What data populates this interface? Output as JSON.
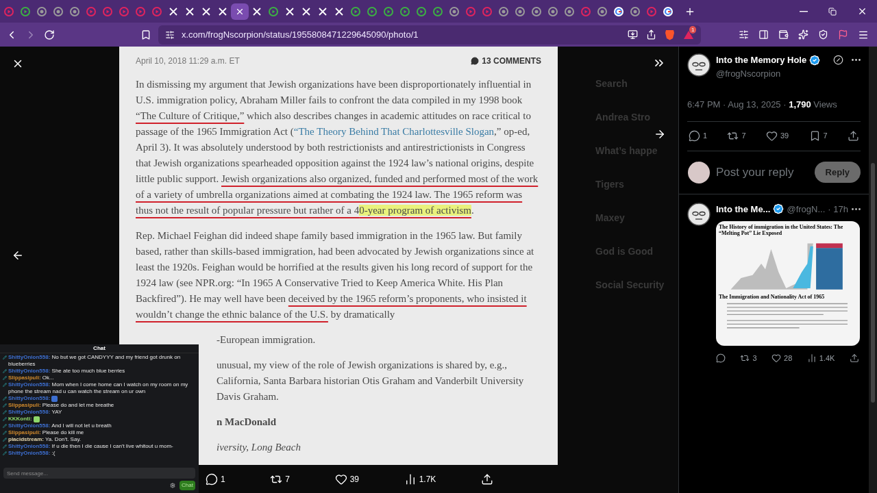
{
  "browser": {
    "tabs": [
      {
        "kind": "media",
        "selected": false
      },
      {
        "kind": "play",
        "selected": false
      },
      {
        "kind": "site",
        "selected": false
      },
      {
        "kind": "site",
        "selected": false
      },
      {
        "kind": "site",
        "selected": false
      },
      {
        "kind": "media",
        "selected": false
      },
      {
        "kind": "media",
        "selected": false
      },
      {
        "kind": "media",
        "selected": false
      },
      {
        "kind": "media",
        "selected": false
      },
      {
        "kind": "media",
        "selected": false
      },
      {
        "kind": "x",
        "selected": false
      },
      {
        "kind": "x",
        "selected": false
      },
      {
        "kind": "x",
        "selected": false
      },
      {
        "kind": "x",
        "selected": false
      },
      {
        "selected": true
      },
      {
        "kind": "x",
        "selected": false
      },
      {
        "kind": "play",
        "selected": false
      },
      {
        "kind": "x",
        "selected": false
      },
      {
        "kind": "x",
        "selected": false
      },
      {
        "kind": "x",
        "selected": false
      },
      {
        "kind": "x",
        "selected": false
      },
      {
        "kind": "play",
        "selected": false
      },
      {
        "kind": "play",
        "selected": false
      },
      {
        "kind": "play",
        "selected": false
      },
      {
        "kind": "play",
        "selected": false
      },
      {
        "kind": "play",
        "selected": false
      },
      {
        "kind": "play",
        "selected": false
      },
      {
        "kind": "site",
        "selected": false
      },
      {
        "kind": "media",
        "selected": false
      },
      {
        "kind": "media",
        "selected": false
      },
      {
        "kind": "site",
        "selected": false
      },
      {
        "kind": "site",
        "selected": false
      },
      {
        "kind": "site",
        "selected": false
      },
      {
        "kind": "site",
        "selected": false
      },
      {
        "kind": "site",
        "selected": false
      },
      {
        "kind": "media",
        "selected": false
      },
      {
        "kind": "site",
        "selected": false
      },
      {
        "kind": "google",
        "selected": false
      },
      {
        "kind": "site",
        "selected": false
      },
      {
        "kind": "media",
        "selected": false
      },
      {
        "kind": "google",
        "selected": false
      }
    ],
    "url": "x.com/frogNscorpion/status/1955808471229645090/photo/1",
    "rewards_badge": "1"
  },
  "background_page": [
    "Search",
    "Andrea Stro",
    "What’s happe",
    "Tigers",
    "Maxey",
    "God is Good",
    "Social Security"
  ],
  "letter": {
    "date": "April 10, 2018 11:29 a.m. ET",
    "comments": "13 COMMENTS",
    "blocks": [
      {
        "kind": "paragraph",
        "runs": [
          {
            "kind": "plain",
            "text": "In dismissing my argument that Jewish organizations have been disproportionately influential in U.S. immigration policy, Abraham Miller fails to confront the data compiled in my 1998 book "
          },
          {
            "kind": "underline",
            "text": "“The Culture of Critique,”"
          },
          {
            "kind": "plain",
            "text": " which also describes changes in academic attitudes on race critical to passage of the 1965 Immigration Act ("
          },
          {
            "kind": "link",
            "text": "“The Theory Behind That Charlottesville Slogan"
          },
          {
            "kind": "plain",
            "text": ",” op-ed, April 3). It was absolutely understood by both restrictionists and antirestrictionists in Congress that Jewish organizations spearheaded opposition against the 1924 law’s national origins, despite little public support. "
          },
          {
            "kind": "underline",
            "text": "Jewish organizations also organized, funded and performed most of the work of a variety of umbrella organizations aimed at combating the 1924 law. The 1965 reform was thus not the result of popular pressure but rather of a 4"
          },
          {
            "kind": "highlight",
            "text": "0-year program of activism"
          },
          {
            "kind": "plain",
            "text": "."
          }
        ]
      },
      {
        "kind": "paragraph",
        "runs": [
          {
            "kind": "plain",
            "text": "Rep. Michael Feighan did indeed shape family based immigration in the 1965 law. But family based, rather than skills-based immigration, had been advocated by Jewish organizations since at least the 1920s. Feighan would be horrified at the results given his long record of support for the 1924 law (see NPR.org: “In 1965 A Conservative Tried to Keep America White. His Plan Backfired”). He may well have been "
          },
          {
            "kind": "underline",
            "text": "deceived by the 1965 reform’s proponents, who insisted it wouldn’t change the ethnic balance of the U.S."
          },
          {
            "kind": "plain",
            "text": " by dramatically"
          }
        ]
      },
      {
        "kind": "fragment",
        "lines": [
          "-European immigration."
        ]
      },
      {
        "kind": "fragment",
        "lines": [
          "unusual, my view of the role of Jewish organizations is shared by, e.g.,",
          "California, Santa Barbara historian Otis Graham and Vanderbilt University",
          "Davis Graham."
        ]
      },
      {
        "kind": "signature",
        "text": "n MacDonald"
      },
      {
        "kind": "affiliation",
        "text": "iversity, Long Beach"
      }
    ]
  },
  "photo_actions": [
    {
      "kind": "reply",
      "count": "1"
    },
    {
      "kind": "repost",
      "count": "7"
    },
    {
      "kind": "like",
      "count": "39"
    },
    {
      "kind": "views",
      "count": "1.7K"
    },
    {
      "kind": "share"
    }
  ],
  "post": {
    "name": "Into the Memory Hole",
    "handle": "@frogNscorpion",
    "time": "6:47 PM · Aug 13, 2025 · ",
    "views_count": "1,790",
    "views_label": " Views",
    "actions": [
      {
        "kind": "reply",
        "count": "1"
      },
      {
        "kind": "repost",
        "count": "7"
      },
      {
        "kind": "like",
        "count": "39"
      },
      {
        "kind": "bookmark",
        "count": "7"
      },
      {
        "kind": "share"
      }
    ]
  },
  "reply_box": {
    "placeholder": "Post your reply",
    "button": "Reply",
    "disabled": true
  },
  "reply_post": {
    "name": "Into the Me...",
    "handle": "@frogN...",
    "time": "· 17h",
    "image_title": "The History of immigration in the United States: The “Melting Pot” Lie Exposed",
    "image_subtitle": "The Immigration and Nationality Act of 1965",
    "actions": [
      {
        "kind": "reply"
      },
      {
        "kind": "repost",
        "count": "3"
      },
      {
        "kind": "like",
        "count": "28"
      },
      {
        "kind": "views",
        "count": "1.4K"
      },
      {
        "kind": "share"
      }
    ]
  },
  "chat": {
    "title": "Chat",
    "messages": [
      {
        "user": "ShittyOnion558:",
        "color": "#3d6fd1",
        "kind": "text",
        "text": "No but we got CANDYYY and my friend got drunk on blueberries"
      },
      {
        "user": "ShittyOnion558:",
        "color": "#3d6fd1",
        "kind": "text",
        "text": "She ate too much blue berries"
      },
      {
        "user": "Slippasipuli:",
        "color": "#d18a2c",
        "kind": "text",
        "text": "Ok..."
      },
      {
        "user": "ShittyOnion558:",
        "color": "#3d6fd1",
        "kind": "text",
        "text": "Mom when I come home can I watch on my room on my phone the stream nad u can watch the stream on ur own"
      },
      {
        "user": "ShittyOnion558:",
        "color": "#3d6fd1",
        "kind": "emote"
      },
      {
        "user": "Slippasipuli:",
        "color": "#d18a2c",
        "kind": "text",
        "text": "Please do and let me breathe"
      },
      {
        "user": "ShittyOnion558:",
        "color": "#3d6fd1",
        "kind": "text",
        "text": "YAY"
      },
      {
        "user": "KKKonti:",
        "color": "#8ed86a",
        "kind": "emote"
      },
      {
        "user": "ShittyOnion558:",
        "color": "#3d6fd1",
        "kind": "text",
        "text": "And I will not let u breath"
      },
      {
        "user": "Slippasipuli:",
        "color": "#d18a2c",
        "kind": "text",
        "text": "Please do kill me"
      },
      {
        "user": "placidstream:",
        "color": "#e8d9b0",
        "kind": "text",
        "text": "Ya. Don't. Say."
      },
      {
        "user": "ShittyOnion558:",
        "color": "#3d6fd1",
        "kind": "text",
        "text": "If u die then I die cause I can't live whitout u mom-"
      },
      {
        "user": "ShittyOnion558:",
        "color": "#3d6fd1",
        "kind": "text",
        "text": ":("
      }
    ],
    "placeholder": "Send message...",
    "button": "Chat"
  }
}
